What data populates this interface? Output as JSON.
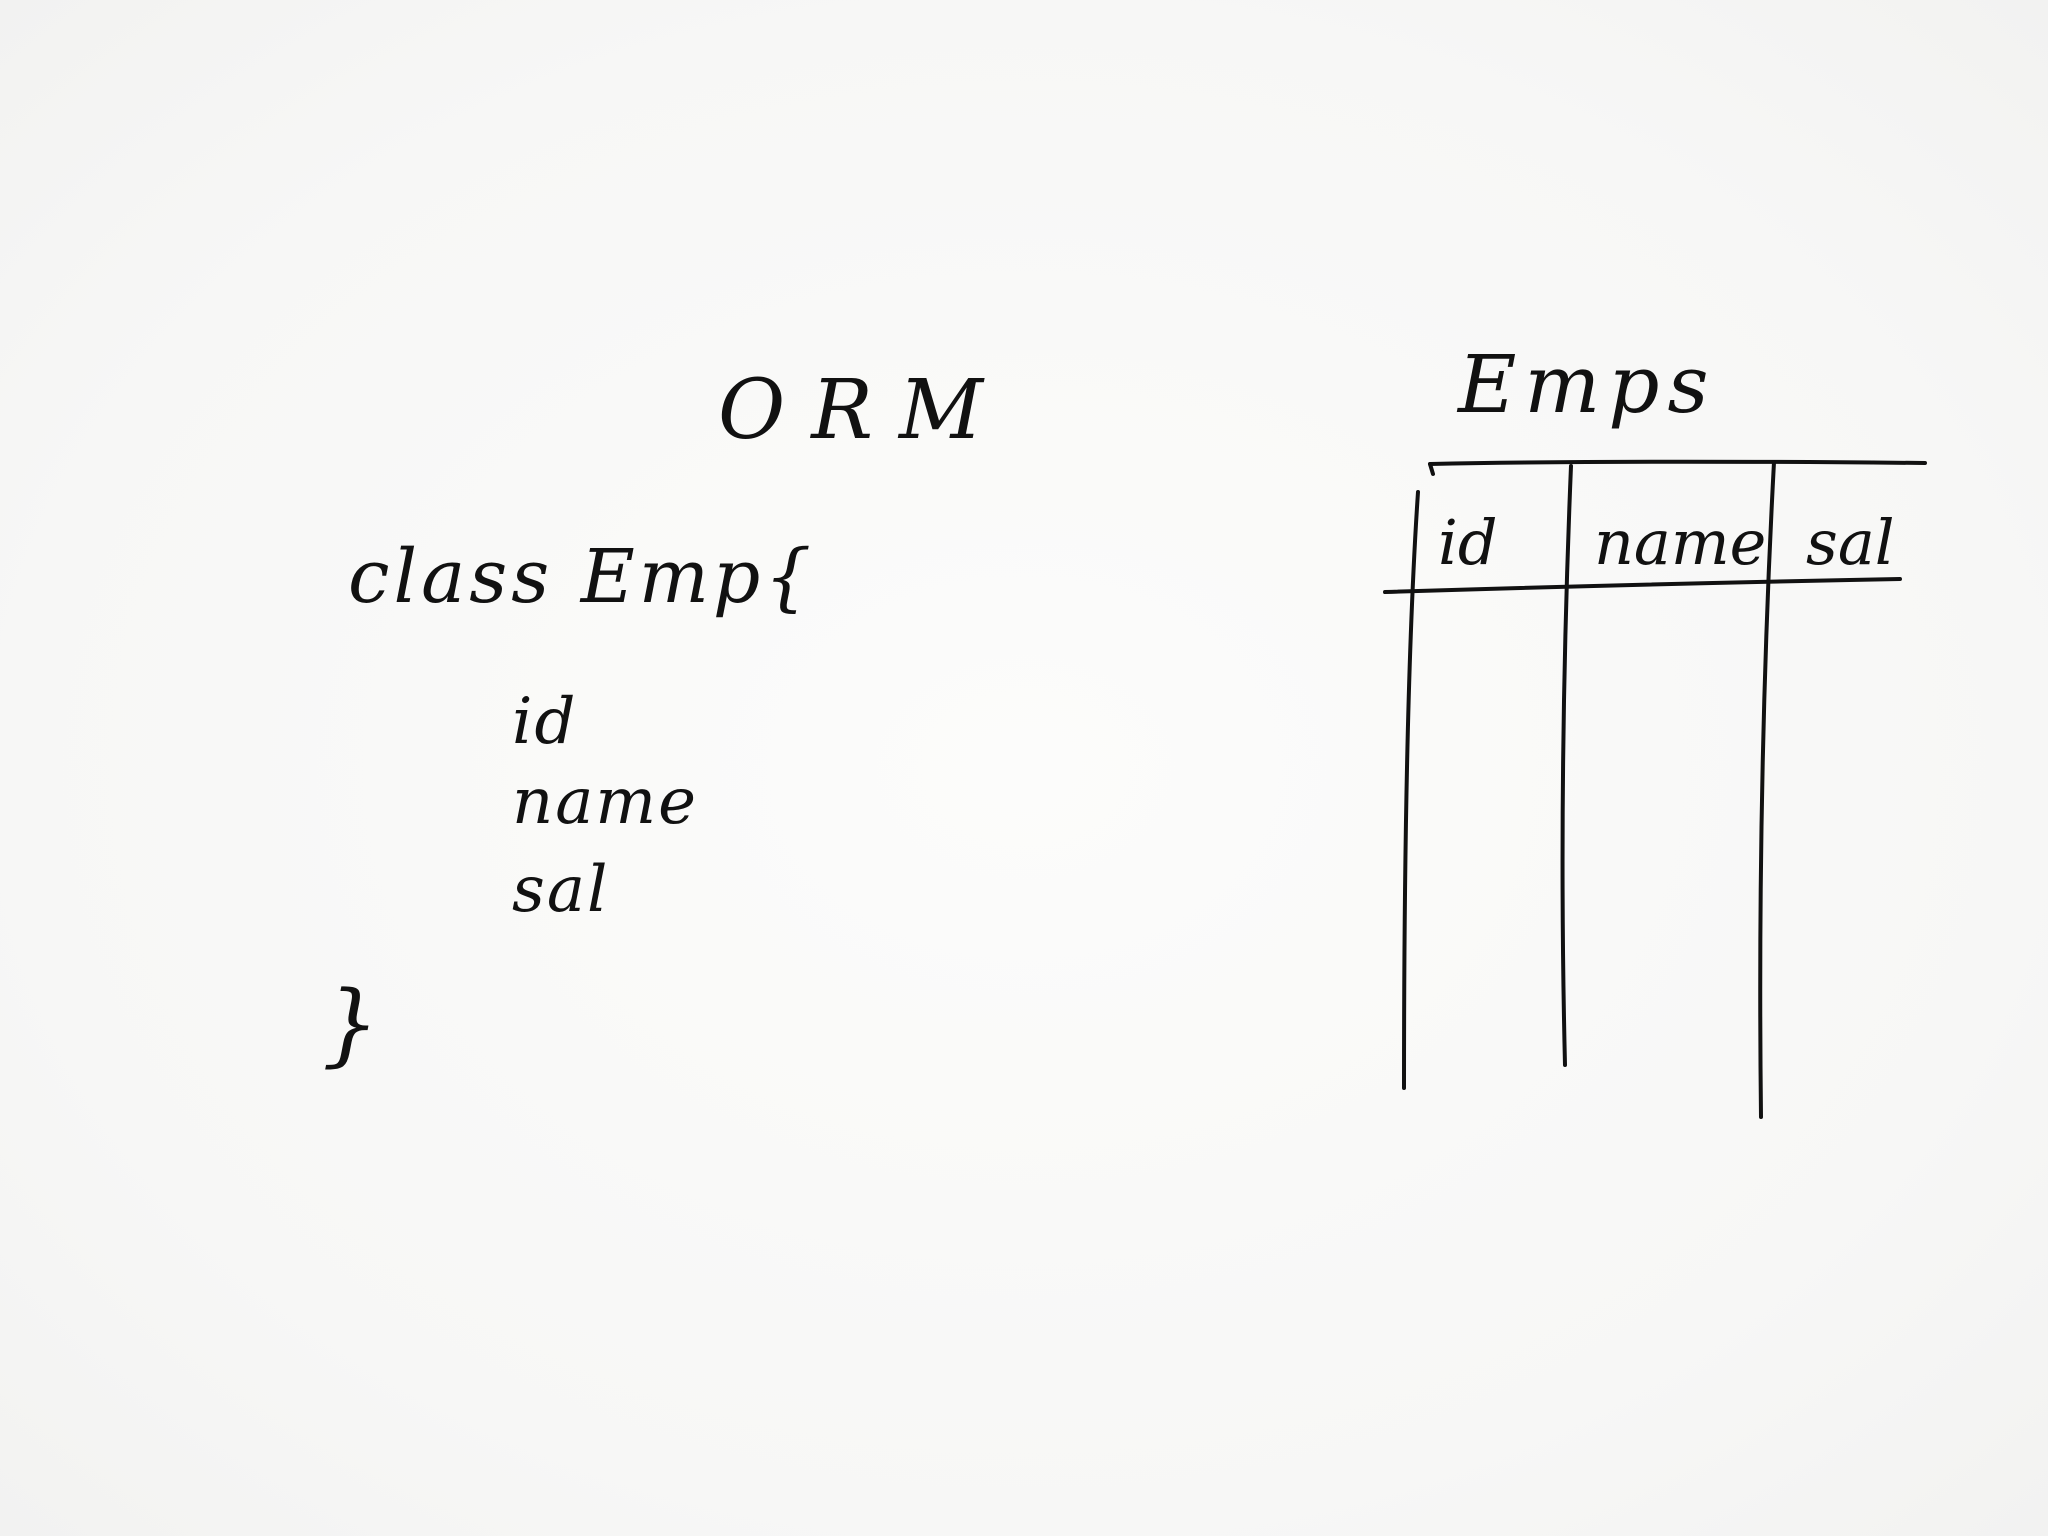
{
  "orm": {
    "title": "ORM",
    "class_declaration": "class Emp{",
    "fields": [
      "id",
      "name",
      "sal"
    ],
    "closing_brace": "}"
  },
  "emps_table": {
    "title": "Emps",
    "columns": [
      "id",
      "name",
      "sal"
    ]
  }
}
